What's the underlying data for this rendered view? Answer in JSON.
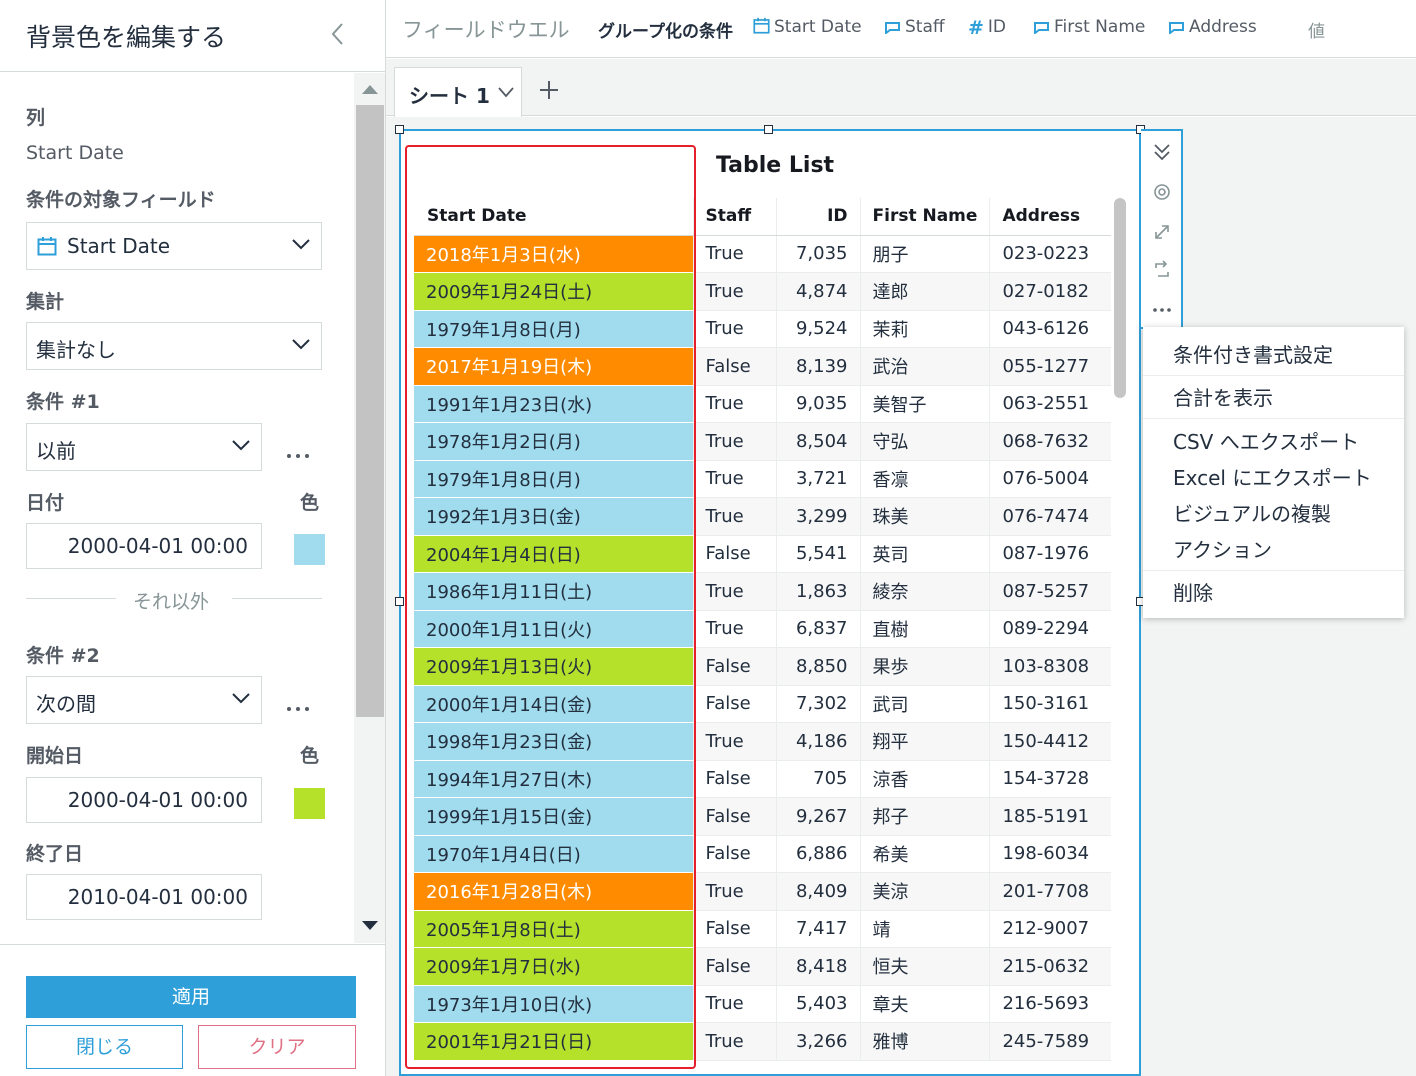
{
  "left_panel": {
    "title": "背景色を編集する",
    "column_label": "列",
    "column_value": "Start Date",
    "target_field_label": "条件の対象フィールド",
    "target_field_value": "Start Date",
    "aggregation_label": "集計",
    "aggregation_value": "集計なし",
    "condition1": {
      "label": "条件 #1",
      "operator": "以前",
      "date_label": "日付",
      "color_label": "色",
      "date_value": "2000-04-01 00:00",
      "color": "#a0dcee"
    },
    "otherwise_label": "それ以外",
    "condition2": {
      "label": "条件 #2",
      "operator": "次の間",
      "start_label": "開始日",
      "color_label": "色",
      "start_value": "2000-04-01 00:00",
      "end_label": "終了日",
      "end_value": "2010-04-01 00:00",
      "color": "#b5e12a"
    },
    "apply_label": "適用",
    "close_label": "閉じる",
    "clear_label": "クリア"
  },
  "fieldwell": {
    "title": "フィールドウエル",
    "group_label": "グループ化の条件",
    "fields": [
      {
        "icon": "calendar-icon",
        "label": "Start Date"
      },
      {
        "icon": "dimension-icon",
        "label": "Staff"
      },
      {
        "icon": "hash-icon",
        "label": "ID"
      },
      {
        "icon": "dimension-icon",
        "label": "First Name"
      },
      {
        "icon": "dimension-icon",
        "label": "Address"
      }
    ],
    "value_label": "値"
  },
  "sheet_tab": {
    "label": "シート 1"
  },
  "visual": {
    "title": "Table List",
    "columns": [
      "Start Date",
      "Staff",
      "ID",
      "First Name",
      "Address"
    ],
    "rows": [
      {
        "date": "2018年1月3日(水)",
        "staff": "True",
        "id": "7,035",
        "name": "朋子",
        "address": "023-0223",
        "bg": "#ff8c00",
        "fg": "#ffffff"
      },
      {
        "date": "2009年1月24日(土)",
        "staff": "True",
        "id": "4,874",
        "name": "達郎",
        "address": "027-0182",
        "bg": "#b5e12a",
        "fg": "#232f3e"
      },
      {
        "date": "1979年1月8日(月)",
        "staff": "True",
        "id": "9,524",
        "name": "茉莉",
        "address": "043-6126",
        "bg": "#a0dcee",
        "fg": "#232f3e"
      },
      {
        "date": "2017年1月19日(木)",
        "staff": "False",
        "id": "8,139",
        "name": "武治",
        "address": "055-1277",
        "bg": "#ff8c00",
        "fg": "#ffffff"
      },
      {
        "date": "1991年1月23日(水)",
        "staff": "True",
        "id": "9,035",
        "name": "美智子",
        "address": "063-2551",
        "bg": "#a0dcee",
        "fg": "#232f3e"
      },
      {
        "date": "1978年1月2日(月)",
        "staff": "True",
        "id": "8,504",
        "name": "守弘",
        "address": "068-7632",
        "bg": "#a0dcee",
        "fg": "#232f3e"
      },
      {
        "date": "1979年1月8日(月)",
        "staff": "True",
        "id": "3,721",
        "name": "香凛",
        "address": "076-5004",
        "bg": "#a0dcee",
        "fg": "#232f3e"
      },
      {
        "date": "1992年1月3日(金)",
        "staff": "True",
        "id": "3,299",
        "name": "珠美",
        "address": "076-7474",
        "bg": "#a0dcee",
        "fg": "#232f3e"
      },
      {
        "date": "2004年1月4日(日)",
        "staff": "False",
        "id": "5,541",
        "name": "英司",
        "address": "087-1976",
        "bg": "#b5e12a",
        "fg": "#232f3e"
      },
      {
        "date": "1986年1月11日(土)",
        "staff": "True",
        "id": "1,863",
        "name": "綾奈",
        "address": "087-5257",
        "bg": "#a0dcee",
        "fg": "#232f3e"
      },
      {
        "date": "2000年1月11日(火)",
        "staff": "True",
        "id": "6,837",
        "name": "直樹",
        "address": "089-2294",
        "bg": "#a0dcee",
        "fg": "#232f3e"
      },
      {
        "date": "2009年1月13日(火)",
        "staff": "False",
        "id": "8,850",
        "name": "果歩",
        "address": "103-8308",
        "bg": "#b5e12a",
        "fg": "#232f3e"
      },
      {
        "date": "2000年1月14日(金)",
        "staff": "False",
        "id": "7,302",
        "name": "武司",
        "address": "150-3161",
        "bg": "#a0dcee",
        "fg": "#232f3e"
      },
      {
        "date": "1998年1月23日(金)",
        "staff": "True",
        "id": "4,186",
        "name": "翔平",
        "address": "150-4412",
        "bg": "#a0dcee",
        "fg": "#232f3e"
      },
      {
        "date": "1994年1月27日(木)",
        "staff": "False",
        "id": "705",
        "name": "涼香",
        "address": "154-3728",
        "bg": "#a0dcee",
        "fg": "#232f3e"
      },
      {
        "date": "1999年1月15日(金)",
        "staff": "False",
        "id": "9,267",
        "name": "邦子",
        "address": "185-5191",
        "bg": "#a0dcee",
        "fg": "#232f3e"
      },
      {
        "date": "1970年1月4日(日)",
        "staff": "False",
        "id": "6,886",
        "name": "希美",
        "address": "198-6034",
        "bg": "#a0dcee",
        "fg": "#232f3e"
      },
      {
        "date": "2016年1月28日(木)",
        "staff": "True",
        "id": "8,409",
        "name": "美涼",
        "address": "201-7708",
        "bg": "#ff8c00",
        "fg": "#ffffff"
      },
      {
        "date": "2005年1月8日(土)",
        "staff": "False",
        "id": "7,417",
        "name": "靖",
        "address": "212-9007",
        "bg": "#b5e12a",
        "fg": "#232f3e"
      },
      {
        "date": "2009年1月7日(水)",
        "staff": "False",
        "id": "8,418",
        "name": "恒夫",
        "address": "215-0632",
        "bg": "#b5e12a",
        "fg": "#232f3e"
      },
      {
        "date": "1973年1月10日(水)",
        "staff": "True",
        "id": "5,403",
        "name": "章夫",
        "address": "216-5693",
        "bg": "#a0dcee",
        "fg": "#232f3e"
      },
      {
        "date": "2001年1月21日(日)",
        "staff": "True",
        "id": "3,266",
        "name": "雅博",
        "address": "245-7589",
        "bg": "#b5e12a",
        "fg": "#232f3e"
      }
    ]
  },
  "context_menu": {
    "items": [
      "条件付き書式設定",
      "合計を表示",
      "CSV へエクスポート",
      "Excel にエクスポート",
      "ビジュアルの複製",
      "アクション",
      "削除"
    ]
  },
  "colors": {
    "accent": "#2e9fd8",
    "highlight_border": "#e5202a",
    "clear_button": "#e07085"
  }
}
